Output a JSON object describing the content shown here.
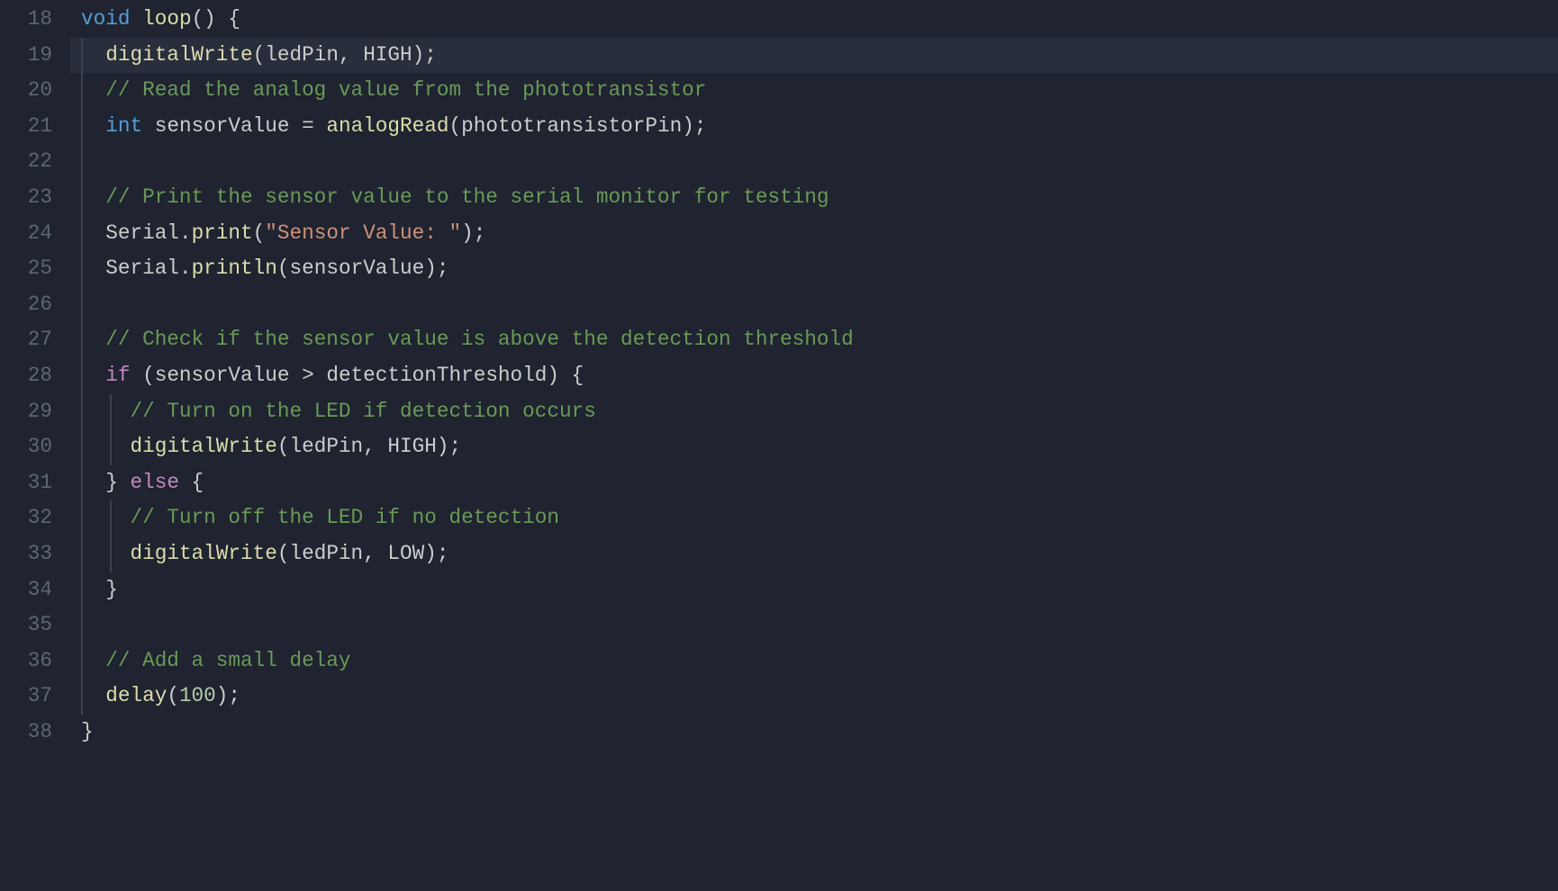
{
  "startLine": 18,
  "lines": [
    {
      "num": 18,
      "highlighted": false,
      "indent": 0,
      "guides": [],
      "tokens": [
        {
          "cls": "t-keyword",
          "text": "void"
        },
        {
          "cls": "t-punct",
          "text": " "
        },
        {
          "cls": "t-func",
          "text": "loop"
        },
        {
          "cls": "t-punct",
          "text": "() {"
        }
      ]
    },
    {
      "num": 19,
      "highlighted": true,
      "indent": 1,
      "guides": [
        0
      ],
      "tokens": [
        {
          "cls": "t-func",
          "text": "digitalWrite"
        },
        {
          "cls": "t-punct",
          "text": "("
        },
        {
          "cls": "t-ident",
          "text": "ledPin"
        },
        {
          "cls": "t-punct",
          "text": ", "
        },
        {
          "cls": "t-ident",
          "text": "HIGH"
        },
        {
          "cls": "t-punct",
          "text": ");"
        }
      ]
    },
    {
      "num": 20,
      "highlighted": false,
      "indent": 1,
      "guides": [
        0
      ],
      "tokens": [
        {
          "cls": "t-comment",
          "text": "// Read the analog value from the phototransistor"
        }
      ]
    },
    {
      "num": 21,
      "highlighted": false,
      "indent": 1,
      "guides": [
        0
      ],
      "tokens": [
        {
          "cls": "t-type",
          "text": "int"
        },
        {
          "cls": "t-punct",
          "text": " "
        },
        {
          "cls": "t-ident",
          "text": "sensorValue"
        },
        {
          "cls": "t-punct",
          "text": " = "
        },
        {
          "cls": "t-func",
          "text": "analogRead"
        },
        {
          "cls": "t-punct",
          "text": "("
        },
        {
          "cls": "t-ident",
          "text": "phototransistorPin"
        },
        {
          "cls": "t-punct",
          "text": ");"
        }
      ]
    },
    {
      "num": 22,
      "highlighted": false,
      "indent": 0,
      "guides": [
        0
      ],
      "tokens": []
    },
    {
      "num": 23,
      "highlighted": false,
      "indent": 1,
      "guides": [
        0
      ],
      "tokens": [
        {
          "cls": "t-comment",
          "text": "// Print the sensor value to the serial monitor for testing"
        }
      ]
    },
    {
      "num": 24,
      "highlighted": false,
      "indent": 1,
      "guides": [
        0
      ],
      "tokens": [
        {
          "cls": "t-ident",
          "text": "Serial"
        },
        {
          "cls": "t-punct",
          "text": "."
        },
        {
          "cls": "t-func",
          "text": "print"
        },
        {
          "cls": "t-punct",
          "text": "("
        },
        {
          "cls": "t-str",
          "text": "\"Sensor Value: \""
        },
        {
          "cls": "t-punct",
          "text": ");"
        }
      ]
    },
    {
      "num": 25,
      "highlighted": false,
      "indent": 1,
      "guides": [
        0
      ],
      "tokens": [
        {
          "cls": "t-ident",
          "text": "Serial"
        },
        {
          "cls": "t-punct",
          "text": "."
        },
        {
          "cls": "t-func",
          "text": "println"
        },
        {
          "cls": "t-punct",
          "text": "("
        },
        {
          "cls": "t-ident",
          "text": "sensorValue"
        },
        {
          "cls": "t-punct",
          "text": ");"
        }
      ]
    },
    {
      "num": 26,
      "highlighted": false,
      "indent": 0,
      "guides": [
        0
      ],
      "tokens": []
    },
    {
      "num": 27,
      "highlighted": false,
      "indent": 1,
      "guides": [
        0
      ],
      "tokens": [
        {
          "cls": "t-comment",
          "text": "// Check if the sensor value is above the detection threshold"
        }
      ]
    },
    {
      "num": 28,
      "highlighted": false,
      "indent": 1,
      "guides": [
        0
      ],
      "tokens": [
        {
          "cls": "t-control",
          "text": "if"
        },
        {
          "cls": "t-punct",
          "text": " ("
        },
        {
          "cls": "t-ident",
          "text": "sensorValue"
        },
        {
          "cls": "t-punct",
          "text": " > "
        },
        {
          "cls": "t-ident",
          "text": "detectionThreshold"
        },
        {
          "cls": "t-punct",
          "text": ") {"
        }
      ]
    },
    {
      "num": 29,
      "highlighted": false,
      "indent": 2,
      "guides": [
        0,
        1
      ],
      "tokens": [
        {
          "cls": "t-comment",
          "text": "// Turn on the LED if detection occurs"
        }
      ]
    },
    {
      "num": 30,
      "highlighted": false,
      "indent": 2,
      "guides": [
        0,
        1
      ],
      "tokens": [
        {
          "cls": "t-func",
          "text": "digitalWrite"
        },
        {
          "cls": "t-punct",
          "text": "("
        },
        {
          "cls": "t-ident",
          "text": "ledPin"
        },
        {
          "cls": "t-punct",
          "text": ", "
        },
        {
          "cls": "t-ident",
          "text": "HIGH"
        },
        {
          "cls": "t-punct",
          "text": ");"
        }
      ]
    },
    {
      "num": 31,
      "highlighted": false,
      "indent": 1,
      "guides": [
        0
      ],
      "tokens": [
        {
          "cls": "t-punct",
          "text": "} "
        },
        {
          "cls": "t-control",
          "text": "else"
        },
        {
          "cls": "t-punct",
          "text": " {"
        }
      ]
    },
    {
      "num": 32,
      "highlighted": false,
      "indent": 2,
      "guides": [
        0,
        1
      ],
      "tokens": [
        {
          "cls": "t-comment",
          "text": "// Turn off the LED if no detection"
        }
      ]
    },
    {
      "num": 33,
      "highlighted": false,
      "indent": 2,
      "guides": [
        0,
        1
      ],
      "tokens": [
        {
          "cls": "t-func",
          "text": "digitalWrite"
        },
        {
          "cls": "t-punct",
          "text": "("
        },
        {
          "cls": "t-ident",
          "text": "ledPin"
        },
        {
          "cls": "t-punct",
          "text": ", "
        },
        {
          "cls": "t-ident",
          "text": "LOW"
        },
        {
          "cls": "t-punct",
          "text": ");"
        }
      ]
    },
    {
      "num": 34,
      "highlighted": false,
      "indent": 1,
      "guides": [
        0
      ],
      "tokens": [
        {
          "cls": "t-punct",
          "text": "}"
        }
      ]
    },
    {
      "num": 35,
      "highlighted": false,
      "indent": 0,
      "guides": [
        0
      ],
      "tokens": []
    },
    {
      "num": 36,
      "highlighted": false,
      "indent": 1,
      "guides": [
        0
      ],
      "tokens": [
        {
          "cls": "t-comment",
          "text": "// Add a small delay"
        }
      ]
    },
    {
      "num": 37,
      "highlighted": false,
      "indent": 1,
      "guides": [
        0
      ],
      "tokens": [
        {
          "cls": "t-func",
          "text": "delay"
        },
        {
          "cls": "t-punct",
          "text": "("
        },
        {
          "cls": "t-num",
          "text": "100"
        },
        {
          "cls": "t-punct",
          "text": ");"
        }
      ]
    },
    {
      "num": 38,
      "highlighted": false,
      "indent": 0,
      "guides": [],
      "tokens": [
        {
          "cls": "t-punct",
          "text": "}"
        }
      ]
    }
  ],
  "indentUnit": "  "
}
